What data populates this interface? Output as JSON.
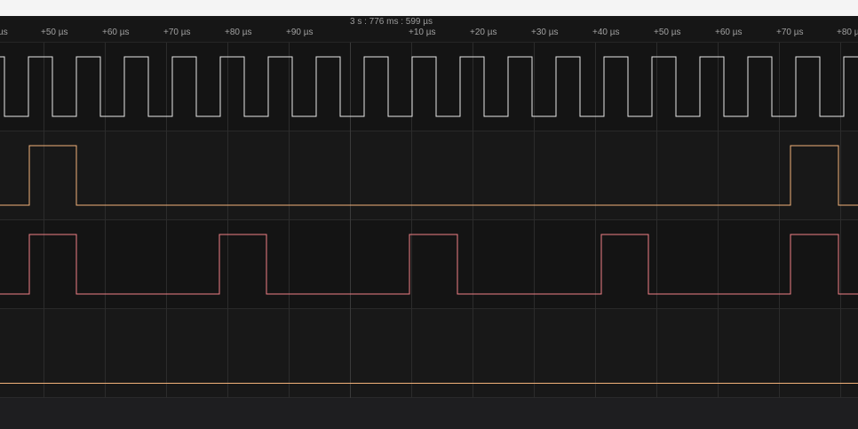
{
  "window": {
    "topbar": ""
  },
  "ruler": {
    "center_time": "3 s : 776 ms : 599 µs",
    "ticks": [
      {
        "label": "µs"
      },
      {
        "label": "+50 µs"
      },
      {
        "label": "+60 µs"
      },
      {
        "label": "+70 µs"
      },
      {
        "label": "+80 µs"
      },
      {
        "label": "+90 µs"
      },
      {
        "label": "+10 µs"
      },
      {
        "label": "+20 µs"
      },
      {
        "label": "+30 µs"
      },
      {
        "label": "+40 µs"
      },
      {
        "label": "+50 µs"
      },
      {
        "label": "+60 µs"
      },
      {
        "label": "+70 µs"
      },
      {
        "label": "+80 µs"
      }
    ]
  },
  "channels": [
    {
      "name": "",
      "color": "#e8e8e8"
    },
    {
      "name": "",
      "color": "#f2b27a"
    },
    {
      "name": "",
      "color": "#f07f86"
    },
    {
      "name": "",
      "color": "#f2b27a"
    }
  ]
}
